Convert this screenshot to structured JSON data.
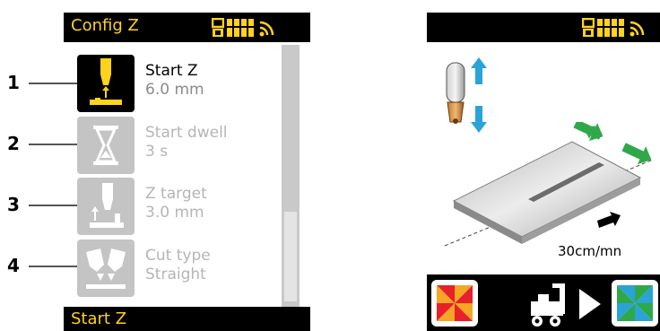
{
  "left_screen": {
    "title": "Config Z",
    "footer_label": "Start Z",
    "menu_items": [
      {
        "callout": "1",
        "label": "Start Z",
        "value": "6.0 mm",
        "icon": "torch-start-z-icon",
        "active": true
      },
      {
        "callout": "2",
        "label": "Start dwell",
        "value": "3 s",
        "icon": "hourglass-icon",
        "active": false
      },
      {
        "callout": "3",
        "label": "Z target",
        "value": "3.0 mm",
        "icon": "torch-z-target-icon",
        "active": false
      },
      {
        "callout": "4",
        "label": "Cut type",
        "value": "Straight",
        "icon": "cut-type-icon",
        "active": false
      }
    ],
    "status_icons": [
      "device-icon",
      "battery-icon",
      "wifi-icon"
    ]
  },
  "right_screen": {
    "speed": "30cm/mn",
    "footer_icons": [
      "stop-icon",
      "carriage-icon",
      "play-icon",
      "start-icon"
    ]
  },
  "colors": {
    "accent": "#ffd21e",
    "header_bg": "#000000",
    "inactive_tile": "#c4c4c4",
    "move_arrow": "#2fa84a",
    "z_arrow": "#29a3d8"
  }
}
